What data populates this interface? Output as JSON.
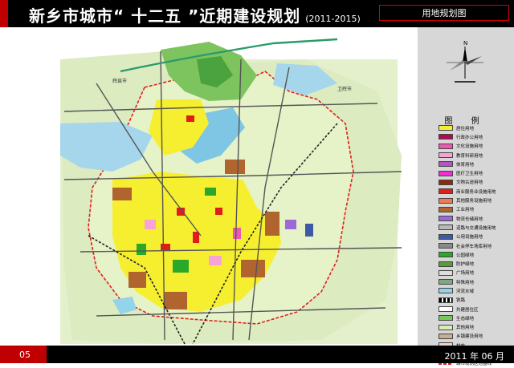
{
  "header": {
    "title": "新乡市城市“ 十二五 ”近期建设规划",
    "years": "(2011-2015)",
    "plan_name": "用地规划图"
  },
  "footer": {
    "page_number": "05",
    "date": "2011 年 06 月"
  },
  "compass": {
    "north": "N"
  },
  "map_labels": {
    "huixian": "辉县市",
    "weihui": "卫辉市"
  },
  "legend": {
    "title": "图 例",
    "items": [
      {
        "label": "居住用地",
        "color": "#f6ef2f"
      },
      {
        "label": "行政办公用地",
        "color": "#ae0d4d"
      },
      {
        "label": "文化设施用地",
        "color": "#ef56b4"
      },
      {
        "label": "教育科研用地",
        "color": "#f7a3d8"
      },
      {
        "label": "体育用地",
        "color": "#b454c4"
      },
      {
        "label": "医疗卫生用地",
        "color": "#f22dd4"
      },
      {
        "label": "文物古迹用地",
        "color": "#8a2a0e"
      },
      {
        "label": "商业服务业设施用地",
        "color": "#e21b1b"
      },
      {
        "label": "其他服务设施用地",
        "color": "#f07a52"
      },
      {
        "label": "工业用地",
        "color": "#b0652f"
      },
      {
        "label": "物流仓储用地",
        "color": "#9c6ad7"
      },
      {
        "label": "道路与交通设施用地",
        "color": "#b8b8b8"
      },
      {
        "label": "公用设施用地",
        "color": "#3d5aa6"
      },
      {
        "label": "社会停车场库用地",
        "color": "#8a8a8a"
      },
      {
        "label": "公园绿地",
        "color": "#29a829"
      },
      {
        "label": "防护绿地",
        "color": "#5c9b3c"
      },
      {
        "label": "广场用地",
        "color": "#dcdcdc"
      },
      {
        "label": "特殊用地",
        "color": "#7ea882"
      },
      {
        "label": "河流水域",
        "color": "#92d4e9"
      },
      {
        "label": "铁路",
        "color": "#ffffff"
      },
      {
        "label": "共建居住区",
        "color": "#ffffff"
      },
      {
        "label": "生态绿地",
        "color": "#74c95a"
      },
      {
        "label": "其他用地",
        "color": "#d8edb2"
      },
      {
        "label": "乡镇建设用地",
        "color": "#c8ae8e"
      },
      {
        "label": "村庄",
        "color": "#e9d9c4"
      },
      {
        "label": "城市发展备用地",
        "color": "#ffffff"
      },
      {
        "label": "城市规划区范围线",
        "color": "#ffffff"
      }
    ]
  }
}
